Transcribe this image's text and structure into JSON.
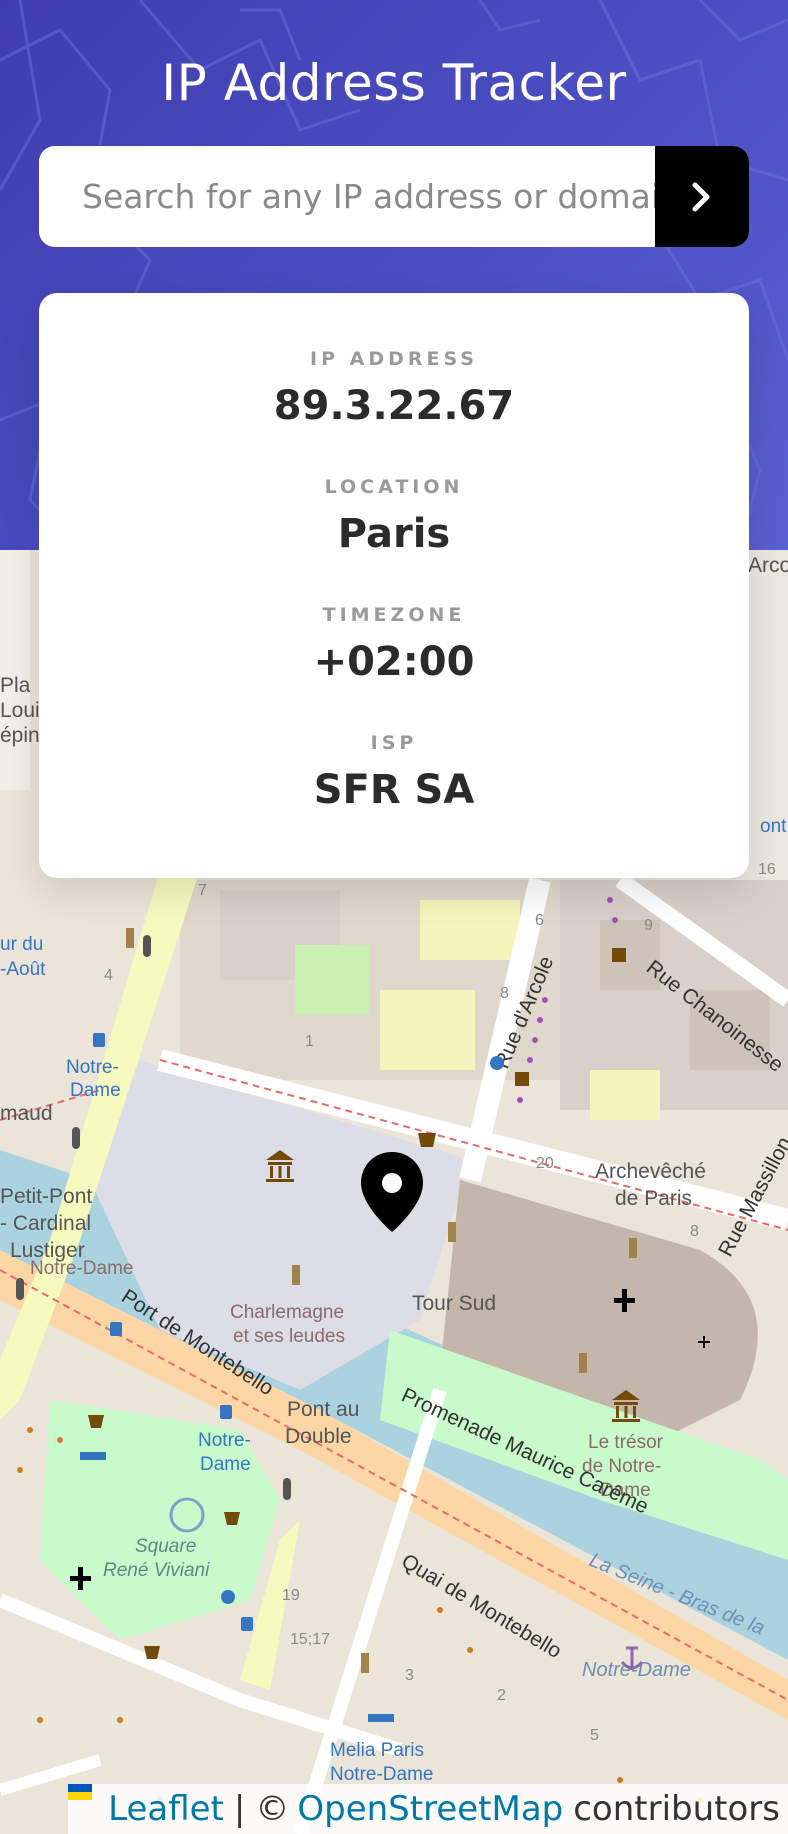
{
  "header": {
    "title": "IP Address Tracker"
  },
  "search": {
    "placeholder": "Search for any IP address or domain",
    "submit_icon": "chevron-right-icon"
  },
  "info": {
    "ip_label": "IP ADDRESS",
    "ip_value": "89.3.22.67",
    "location_label": "LOCATION",
    "location_value": "Paris",
    "timezone_label": "TIMEZONE",
    "timezone_value": "+02:00",
    "isp_label": "ISP",
    "isp_value": "SFR SA"
  },
  "map": {
    "labels": {
      "archeveche": "Archevêché",
      "de_paris": "de Paris",
      "tour_sud": "Tour Sud",
      "charlemagne": "Charlemagne",
      "et_ses_leudes": "et ses leudes",
      "pont_au": "Pont au",
      "double": "Double",
      "port_montebello": "Port de Montebello",
      "promenade": "Promenade Maurice Carême",
      "quai_montebello": "Quai de Montebello",
      "la_seine": "La Seine - Bras de la",
      "notre_dame_1": "Notre-",
      "notre_dame_1b": "Dame",
      "notre_dame_2": "Notre-",
      "notre_dame_2b": "Dame",
      "notre_dame_anchor": "Notre-Dame",
      "le_tresor": "Le trésor",
      "de_notre": "de Notre-",
      "dame": "Dame",
      "square": "Square",
      "rene_viviani": "René Viviani",
      "rue_arcole": "Rue d'Arcole",
      "rue_chanoinesse": "Rue Chanoinesse",
      "rue_massillon": "Rue Massillon",
      "petit_pont": "Petit-Pont",
      "cardinal": "- Cardinal",
      "lustiger": "Lustiger",
      "notre_dame_small": "Notre-Dame",
      "melia": "Melia Paris",
      "melia2": "Notre-Dame",
      "naud": "maud",
      "place": "Pla",
      "louis": "Louis",
      "lepine": "épin",
      "aout": "ur du",
      "aout2": "-Août",
      "arco": "Arco",
      "font": "ont",
      "num_16": "16",
      "num_20": "20",
      "num_8a": "8",
      "num_8b": "8",
      "num_9": "9",
      "num_6": "6",
      "num_7": "7",
      "num_4": "4",
      "num_1": "1",
      "num_19": "19",
      "num_1517": "15;17",
      "num_3": "3",
      "num_2": "2",
      "num_5": "5"
    },
    "marker_icon": "location-pin-icon"
  },
  "attribution": {
    "leaflet": "Leaflet",
    "copyright": "©",
    "osm": "OpenStreetMap",
    "contributors": "contributors"
  },
  "colors": {
    "header_start": "#3f3db0",
    "header_end": "#5a5fd0",
    "water": "#aad3df",
    "pedestrian": "#dddde8",
    "building": "#d9d0c9",
    "cathedral": "#c4b6ab",
    "park": "#c8facc",
    "primary_road": "#fcd6a4",
    "secondary_road": "#f7fabf"
  }
}
